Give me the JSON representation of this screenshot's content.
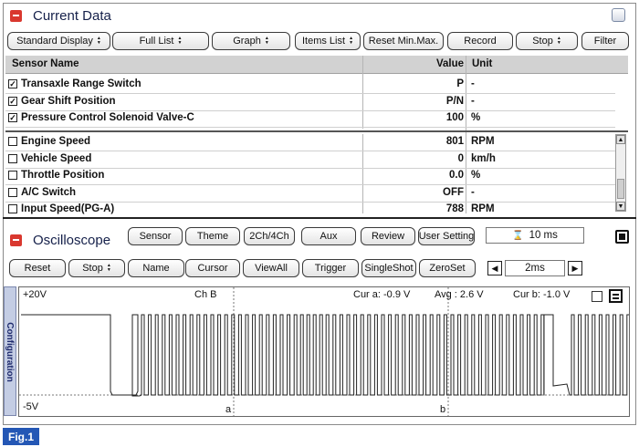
{
  "current_data": {
    "title": "Current Data",
    "toolbar": [
      {
        "label": "Standard Display",
        "dropdown": true
      },
      {
        "label": "Full List",
        "dropdown": true
      },
      {
        "label": "Graph",
        "dropdown": true
      },
      {
        "label": "Items List",
        "dropdown": true
      },
      {
        "label": "Reset Min.Max.",
        "dropdown": false
      },
      {
        "label": "Record",
        "dropdown": false
      },
      {
        "label": "Stop",
        "dropdown": true
      },
      {
        "label": "Filter",
        "dropdown": false
      }
    ],
    "columns": {
      "name": "Sensor Name",
      "value": "Value",
      "unit": "Unit"
    },
    "fixed_rows": [
      {
        "name": "Transaxle Range Switch",
        "value": "P",
        "unit": "-",
        "checked": true
      },
      {
        "name": "Gear Shift Position",
        "value": "P/N",
        "unit": "-",
        "checked": true
      },
      {
        "name": "Pressure Control Solenoid Valve-C",
        "value": "100",
        "unit": "%",
        "checked": true
      }
    ],
    "rows": [
      {
        "name": "Engine Speed",
        "value": "801",
        "unit": "RPM",
        "checked": false
      },
      {
        "name": "Vehicle Speed",
        "value": "0",
        "unit": "km/h",
        "checked": false
      },
      {
        "name": "Throttle Position",
        "value": "0.0",
        "unit": "%",
        "checked": false
      },
      {
        "name": "A/C Switch",
        "value": "OFF",
        "unit": "-",
        "checked": false
      },
      {
        "name": "Input Speed(PG-A)",
        "value": "788",
        "unit": "RPM",
        "checked": false
      }
    ]
  },
  "oscilloscope": {
    "title": "Oscilloscope",
    "top_buttons": [
      "Sensor",
      "Theme",
      "2Ch/4Ch",
      "Aux",
      "Review",
      "User Setting"
    ],
    "time_value": "10 ms",
    "controls": [
      {
        "label": "Reset",
        "dropdown": false
      },
      {
        "label": "Stop",
        "dropdown": true
      },
      {
        "label": "Name",
        "dropdown": false
      },
      {
        "label": "Cursor",
        "dropdown": false
      },
      {
        "label": "ViewAll",
        "dropdown": false
      },
      {
        "label": "Trigger",
        "dropdown": false
      },
      {
        "label": "SingleShot",
        "dropdown": false
      },
      {
        "label": "ZeroSet",
        "dropdown": false
      }
    ],
    "timebase": "2ms",
    "side_tab": "Configuration",
    "plot": {
      "y_top": "+20V",
      "y_bottom": "-5V",
      "channel": "Ch B",
      "cur_a": "Cur a: -0.9 V",
      "avg": "Avg : 2.6 V",
      "cur_b": "Cur b: -1.0 V",
      "cursor_a": "a",
      "cursor_b": "b"
    }
  },
  "figure_label": "Fig.1",
  "colors": {
    "accent": "#d9382f",
    "fig_bg": "#2457b5",
    "tab_bg": "#c4cde4"
  }
}
